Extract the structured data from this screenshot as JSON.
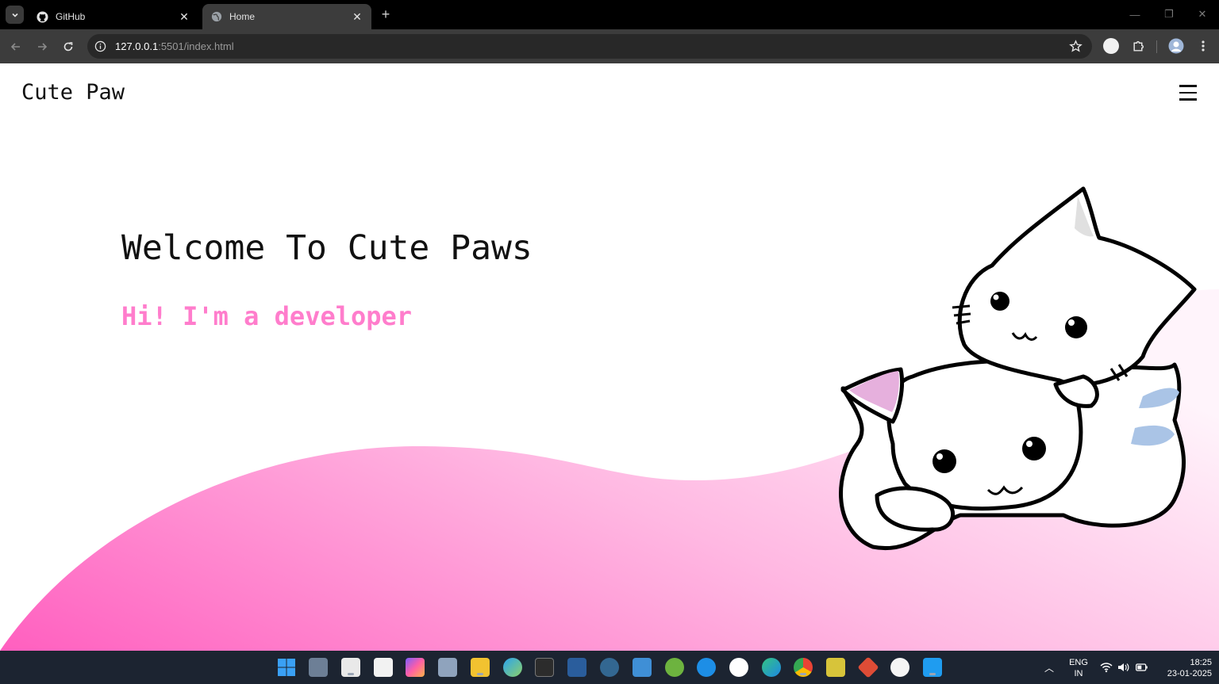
{
  "browser": {
    "tabs": [
      {
        "title": "GitHub",
        "icon": "github-icon",
        "active": false
      },
      {
        "title": "Home",
        "icon": "globe-icon",
        "active": true
      }
    ],
    "url_host": "127.0.0.1",
    "url_rest": ":5501/index.html"
  },
  "page": {
    "brand": "Cute Paw",
    "hero_title": "Welcome To Cute Paws",
    "hero_subtitle": "Hi! I'm a developer",
    "accent_color": "#ff7dcc",
    "wave_gradient": [
      "#ff5fbf",
      "#ffb8e2",
      "#fff4fb"
    ],
    "illustration": "two-white-kittens-illustration"
  },
  "taskbar": {
    "language_line1": "ENG",
    "language_line2": "IN",
    "time": "18:25",
    "date": "23-01-2025"
  }
}
